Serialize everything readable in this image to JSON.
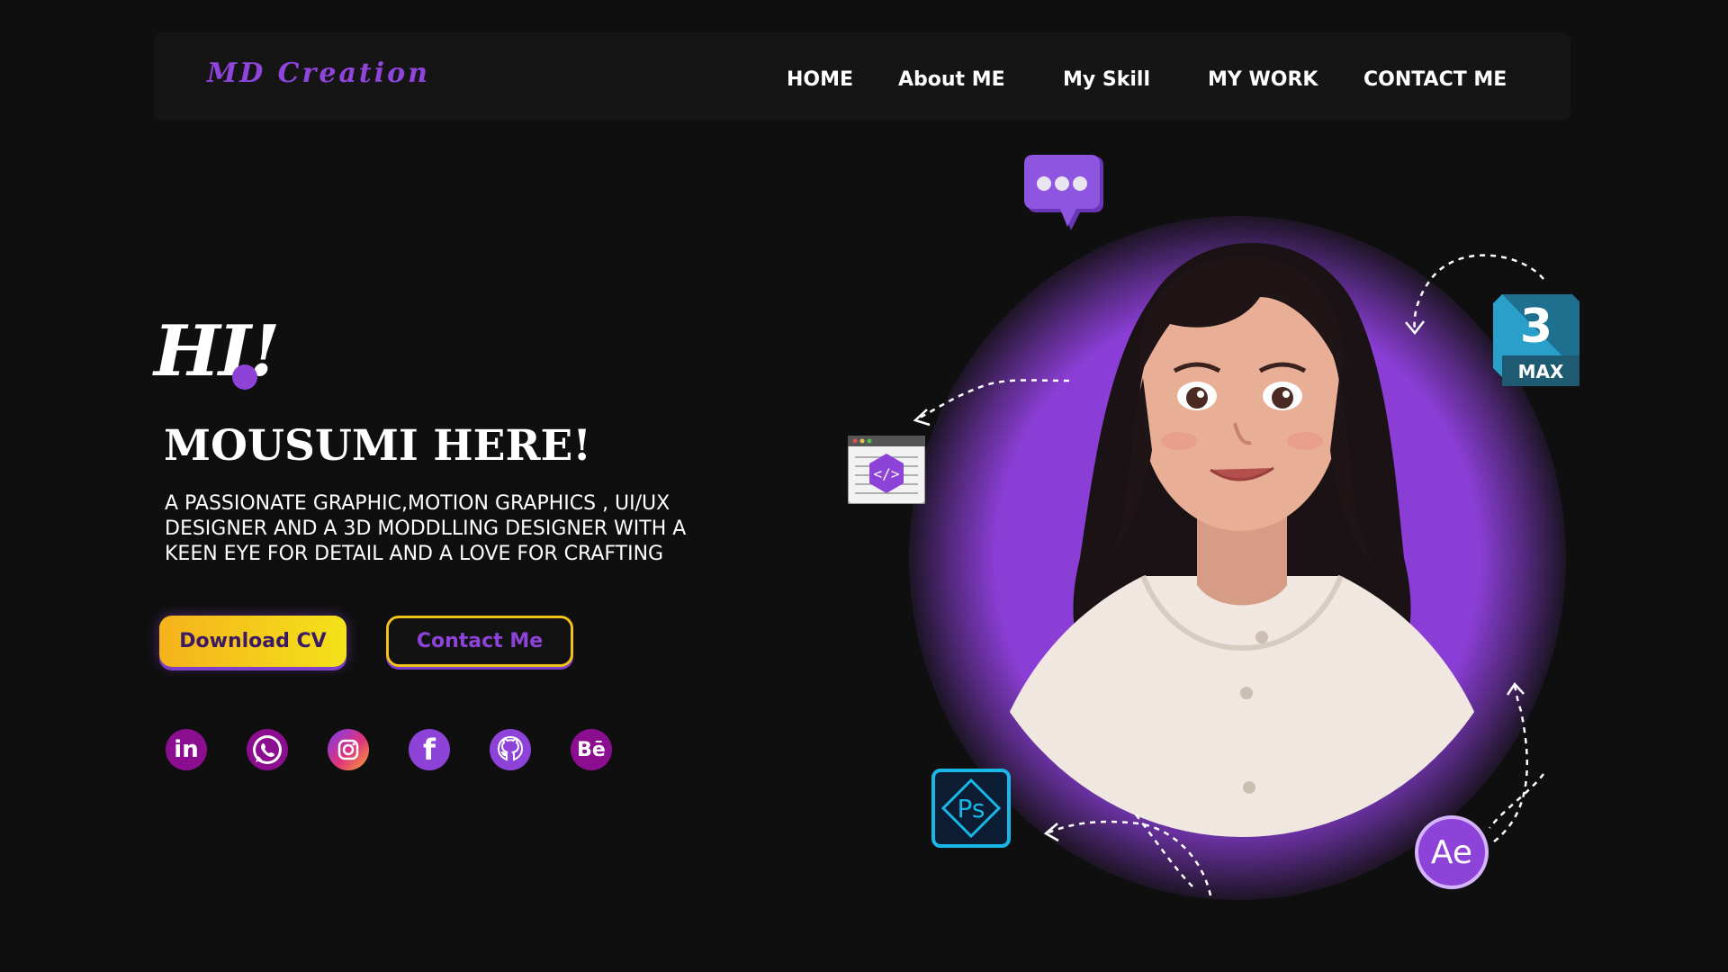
{
  "brand": {
    "logo_text": "MD Creation",
    "accent": "#8e43d8",
    "yellow": "#f4c21b"
  },
  "nav": {
    "items": [
      {
        "label": "HOME"
      },
      {
        "label": "About ME"
      },
      {
        "label": "My Skill"
      },
      {
        "label": "MY WORK"
      },
      {
        "label": "CONTACT ME"
      }
    ]
  },
  "hero": {
    "greeting": "HI!",
    "headline": "MOUSUMI HERE!",
    "description": "A PASSIONATE GRAPHIC,MOTION GRAPHICS , UI/UX DESIGNER AND A 3D MODDLLING DESIGNER  WITH A KEEN EYE FOR DETAIL AND A LOVE FOR CRAFTING",
    "download_label": "Download CV",
    "contact_label": "Contact Me"
  },
  "socials": [
    {
      "name": "linkedin-icon",
      "glyph": "in"
    },
    {
      "name": "whatsapp-icon",
      "glyph": ""
    },
    {
      "name": "instagram-icon",
      "glyph": ""
    },
    {
      "name": "facebook-icon",
      "glyph": "f"
    },
    {
      "name": "github-icon",
      "glyph": ""
    },
    {
      "name": "behance-icon",
      "glyph": "Bē"
    }
  ],
  "floating_icons": {
    "chat": "chat-bubble-icon",
    "code": "code-window-icon",
    "max_number": "3",
    "max_label": "MAX",
    "ps_label": "Ps",
    "ae_label": "Ae"
  }
}
